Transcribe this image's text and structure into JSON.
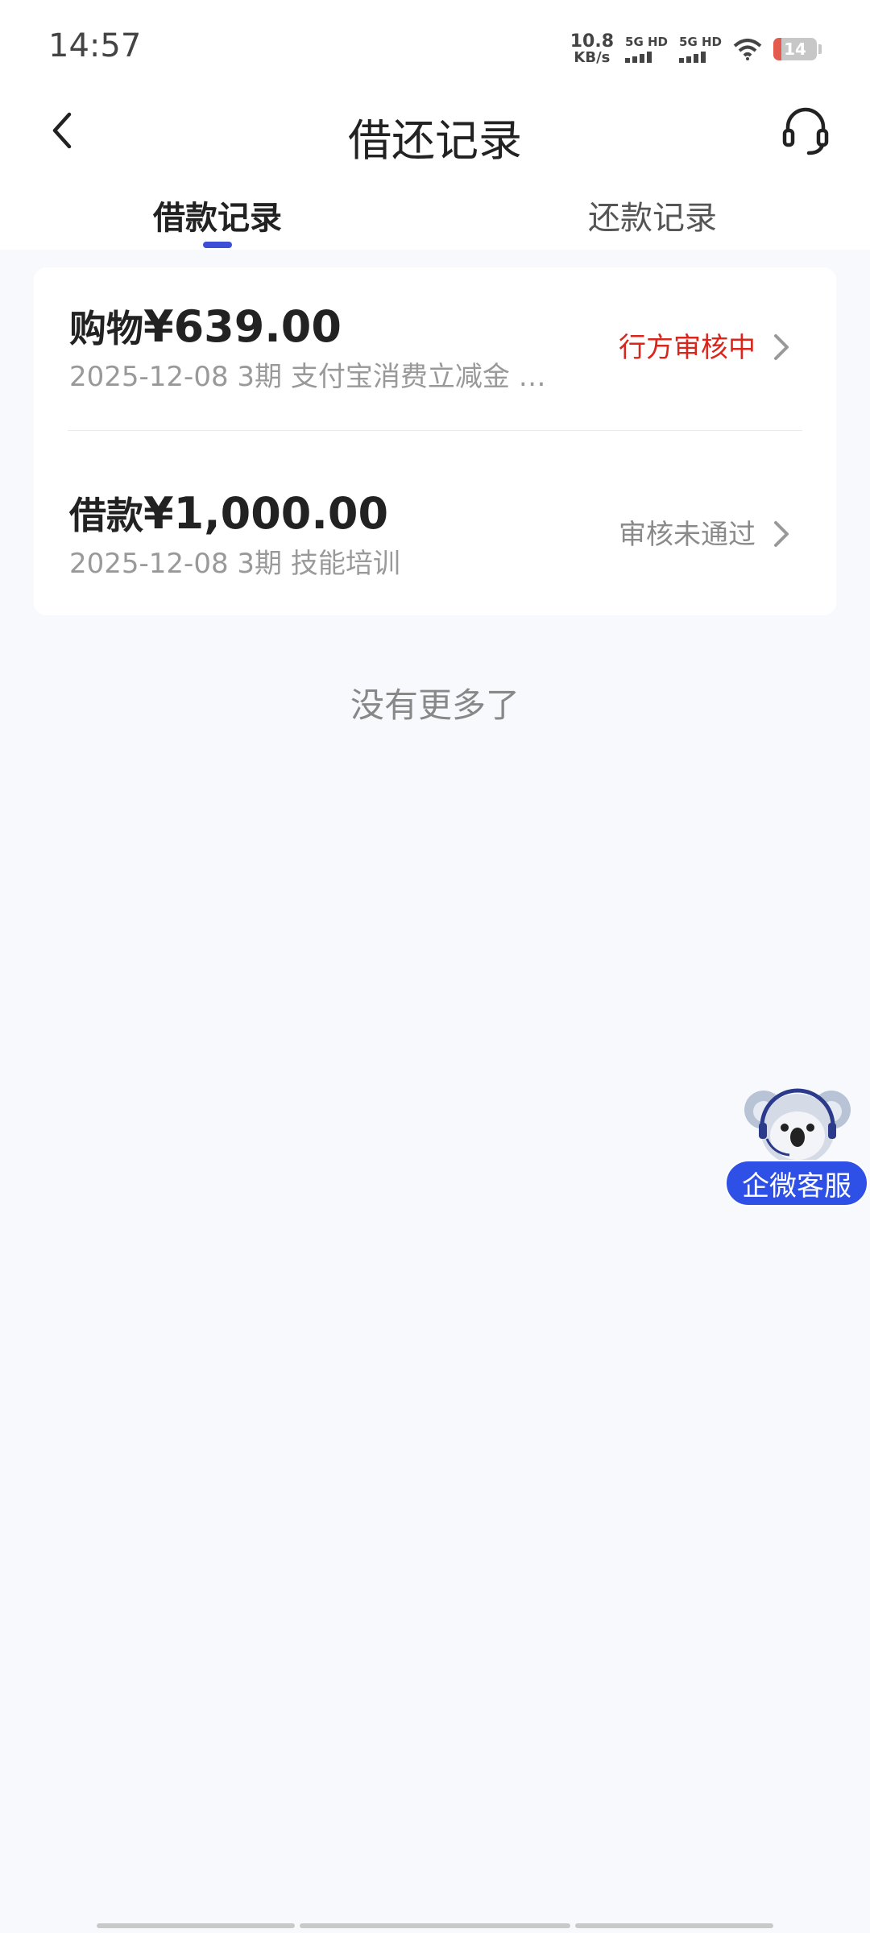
{
  "status_bar": {
    "time": "14:57",
    "net_speed_value": "10.8",
    "net_speed_unit": "KB/s",
    "signal1_label": "5G HD",
    "signal2_label": "5G HD",
    "battery_level": "14"
  },
  "nav": {
    "title": "借还记录",
    "back_icon": "chevron-left-icon",
    "service_icon": "headset-icon"
  },
  "tabs": [
    {
      "label": "借款记录",
      "active": true
    },
    {
      "label": "还款记录",
      "active": false
    }
  ],
  "records": [
    {
      "type": "购物",
      "amount": "¥639.00",
      "detail": "2025-12-08 3期  支付宝消费立减金 …",
      "status": "行方审核中",
      "status_color": "#d9261c"
    },
    {
      "type": "借款",
      "amount": "¥1,000.00",
      "detail": "2025-12-08 3期  技能培训",
      "status": "审核未通过",
      "status_color": "#8a8a8a"
    }
  ],
  "footer_text": "没有更多了",
  "float_service": {
    "label": "企微客服",
    "icon": "koala-mascot-icon"
  },
  "colors": {
    "accent": "#3d4fd6",
    "float_button": "#2f50e6",
    "background": "#f8f9fd"
  }
}
